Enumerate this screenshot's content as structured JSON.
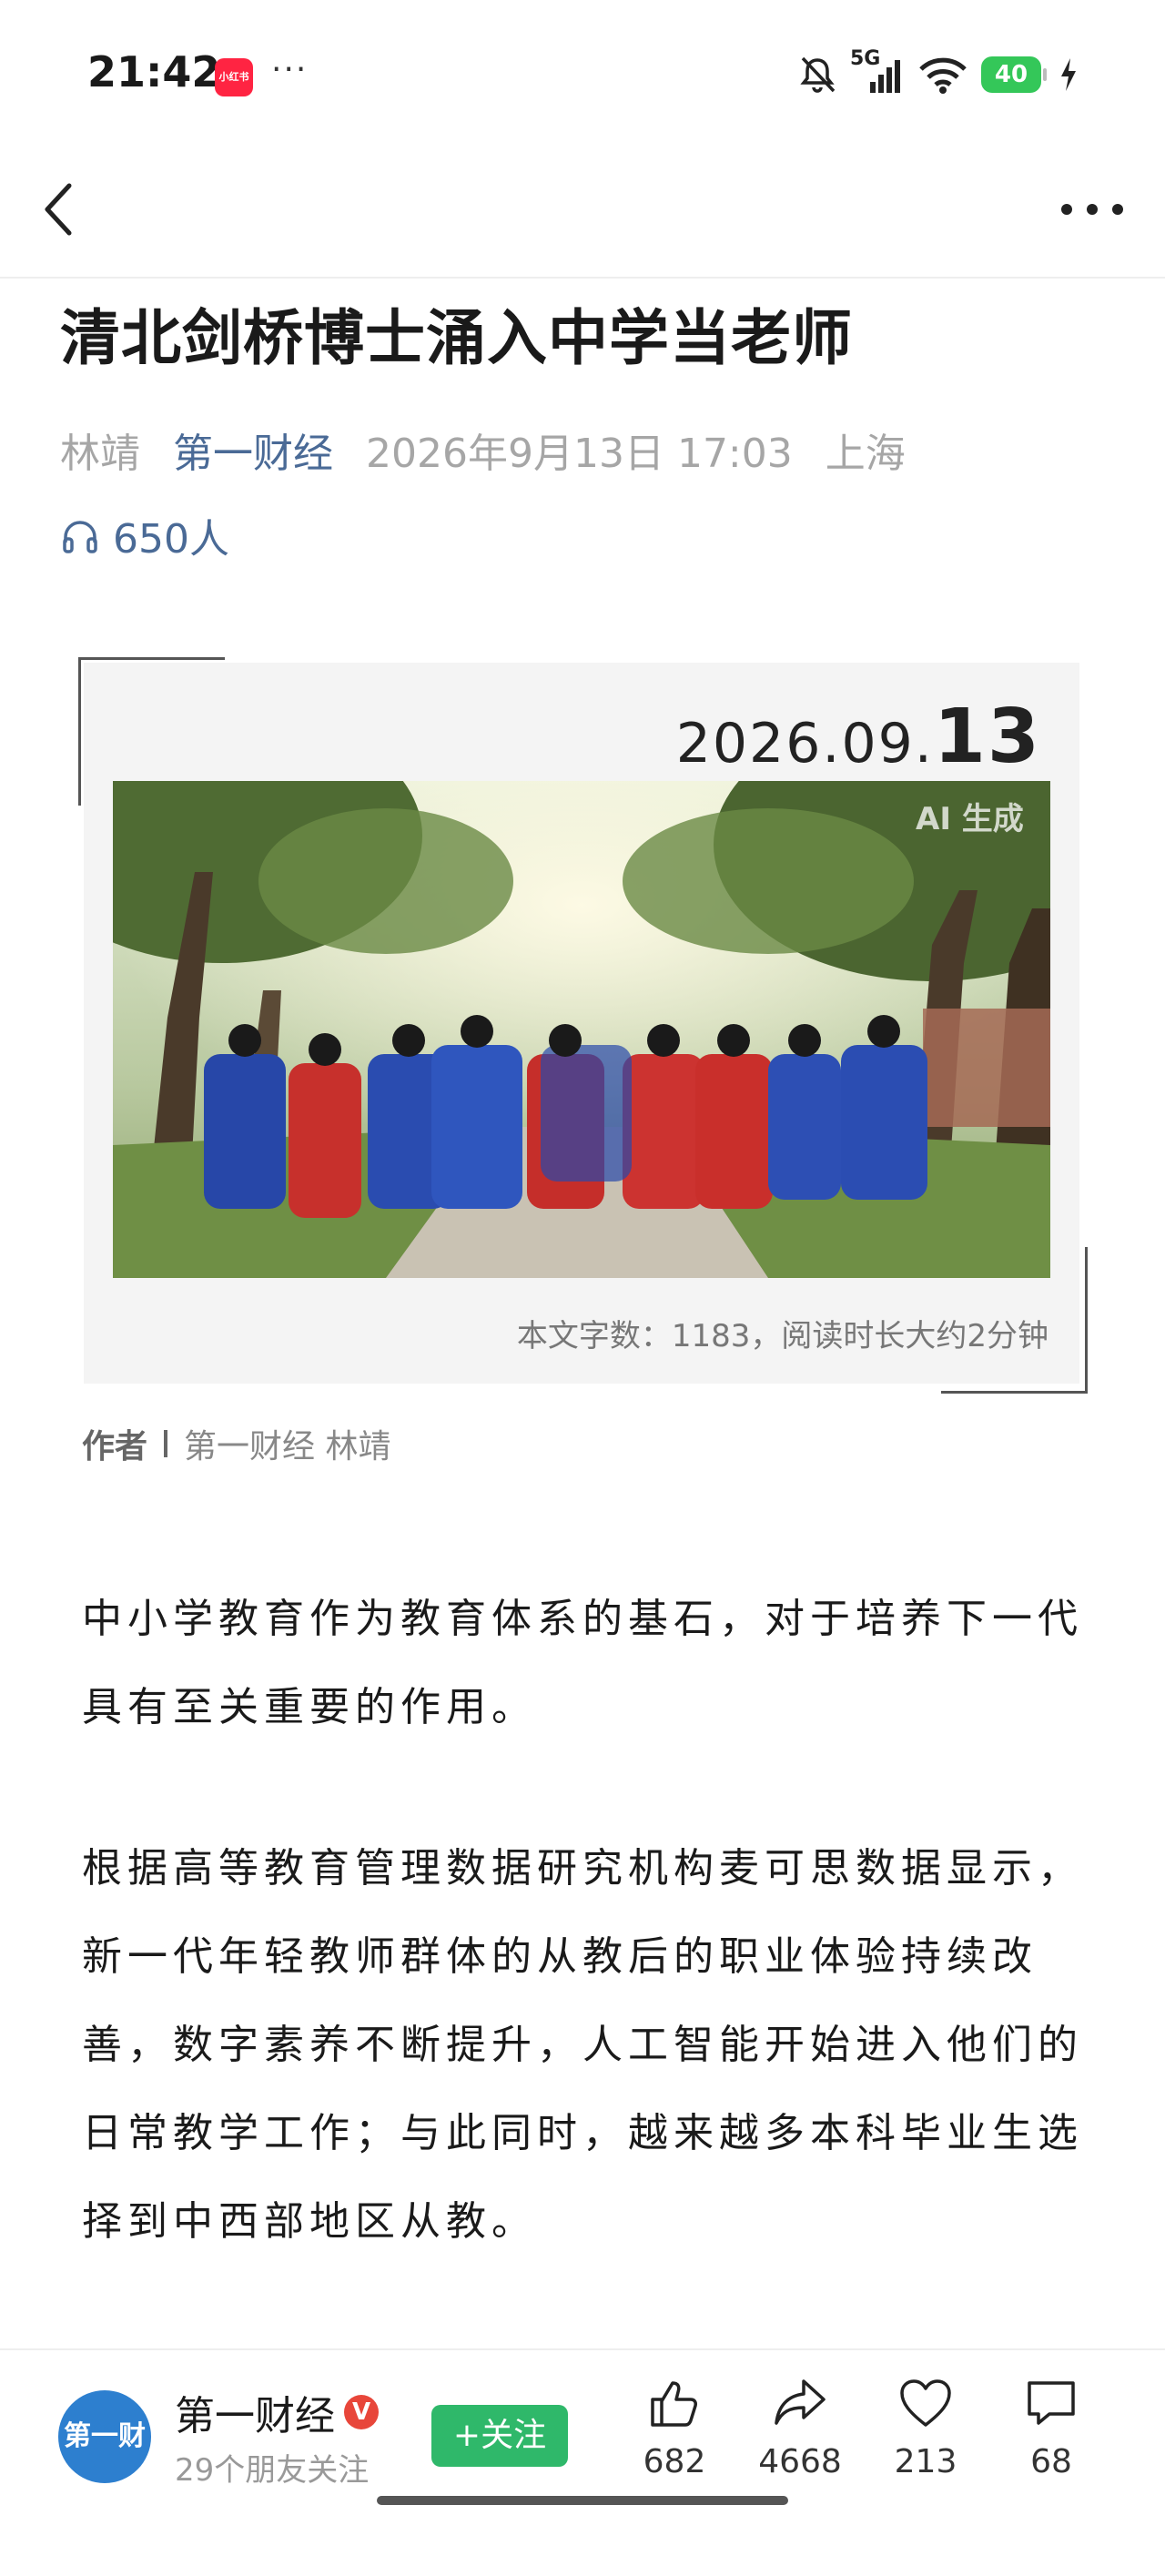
{
  "status_bar": {
    "time": "21:42",
    "app_badge": "小红书",
    "more": "···",
    "network": "5G",
    "battery": "40"
  },
  "article": {
    "title": "清北剑桥博士涌入中学当老师",
    "author": "林靖",
    "source": "第一财经",
    "datetime": "2026年9月13日 17:03",
    "location": "上海",
    "listeners": "650人"
  },
  "card": {
    "date_prefix": "2026.09.",
    "date_day": "13",
    "ai_tag": "AI 生成",
    "word_count": "本文字数：1183，阅读时长大约2分钟"
  },
  "byline": {
    "label": "作者",
    "names": "第一财经  林靖"
  },
  "paragraphs": [
    "中小学教育作为教育体系的基石，对于培养下一代具有至关重要的作用。",
    "根据高等教育管理数据研究机构麦可思数据显示，新一代年轻教师群体的从教后的职业体验持续改善，数字素养不断提升，人工智能开始进入他们的日常教学工作；与此同时，越来越多本科毕业生选择到中西部地区从教。"
  ],
  "bottom_bar": {
    "avatar_text": "第一财经",
    "account_name": "第一财经",
    "verified_badge": "V",
    "friends": "29个朋友关注",
    "follow_label": "+关注",
    "likes": "682",
    "shares": "4668",
    "favorites": "213",
    "comments": "68"
  },
  "colors": {
    "link_blue": "#4a6a96",
    "follow_green": "#2fb86a",
    "battery_green": "#34c759"
  }
}
